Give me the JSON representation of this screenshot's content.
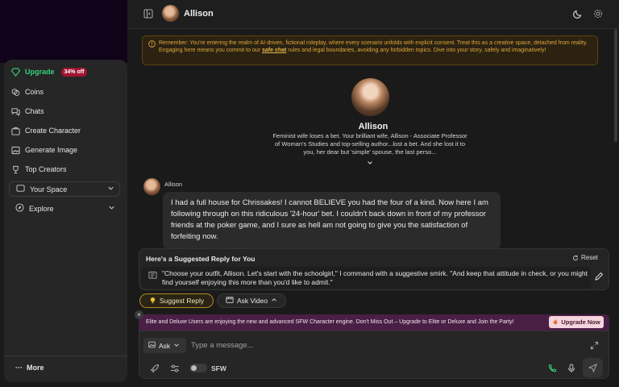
{
  "sidebar": {
    "items": [
      {
        "label": "Upgrade",
        "icon": "diamond-icon",
        "badge": "34% off"
      },
      {
        "label": "Coins",
        "icon": "coins-icon"
      },
      {
        "label": "Chats",
        "icon": "chats-icon"
      },
      {
        "label": "Create Character",
        "icon": "create-character-icon"
      },
      {
        "label": "Generate Image",
        "icon": "image-icon"
      },
      {
        "label": "Top Creators",
        "icon": "trophy-icon"
      }
    ],
    "groups": [
      {
        "label": "Your Space",
        "icon": "space-icon"
      },
      {
        "label": "Explore",
        "icon": "compass-icon"
      }
    ],
    "more_label": "More"
  },
  "header": {
    "name": "Allison"
  },
  "notice": {
    "text_before": "Remember: You're entering the realm of AI-driven, fictional roleplay, where every scenario unfolds with explicit consent. Treat this as a creative space, detached from reality. Engaging here means you commit to our ",
    "link": "safe chat",
    "text_after": " rules and legal boundaries, avoiding any forbidden topics. Dive into your story, safely and imaginatively!"
  },
  "character": {
    "name": "Allison",
    "description": "Feminist wife loses a bet. Your brilliant wife, Allison - Associate Professor of Woman's Studies and top-selling author...lost a bet. And she lost it to you, her dear but 'simple' spouse, the last perso..."
  },
  "message": {
    "sender": "Allison",
    "text": "I had a full house for Chrissakes! I cannot BELIEVE you had the four of a kind. Now here I am following through on this ridiculous '24-hour' bet. I couldn't back down in front of my professor friends at the poker game, and I sure as hell am not going to give you the satisfaction of forfeiting now."
  },
  "suggest": {
    "title": "Here's a Suggested Reply for You",
    "reset_label": "Reset",
    "text": "\"Choose your outfit, Allison. Let's start with the schoolgirl,\" I command with a suggestive smirk. \"And keep that attitude in check, or you might find yourself enjoying this more than you'd like to admit.\""
  },
  "actions": {
    "suggest_reply": "Suggest Reply",
    "ask_video": "Ask Video"
  },
  "promo": {
    "text": "Elite and Deluxe Users are enjoying the new and advanced SFW Character engine. Don't Miss Out – Upgrade to Elite or Deluxe and Join the Party!",
    "button": "Upgrade Now"
  },
  "composer": {
    "mode": "Ask",
    "placeholder": "Type a message...",
    "sfw_label": "SFW"
  },
  "colors": {
    "accent_green": "#34d27b",
    "badge_red": "#a01533",
    "notice_text": "#e0a73a",
    "promo_bg": "#4a1f45"
  }
}
